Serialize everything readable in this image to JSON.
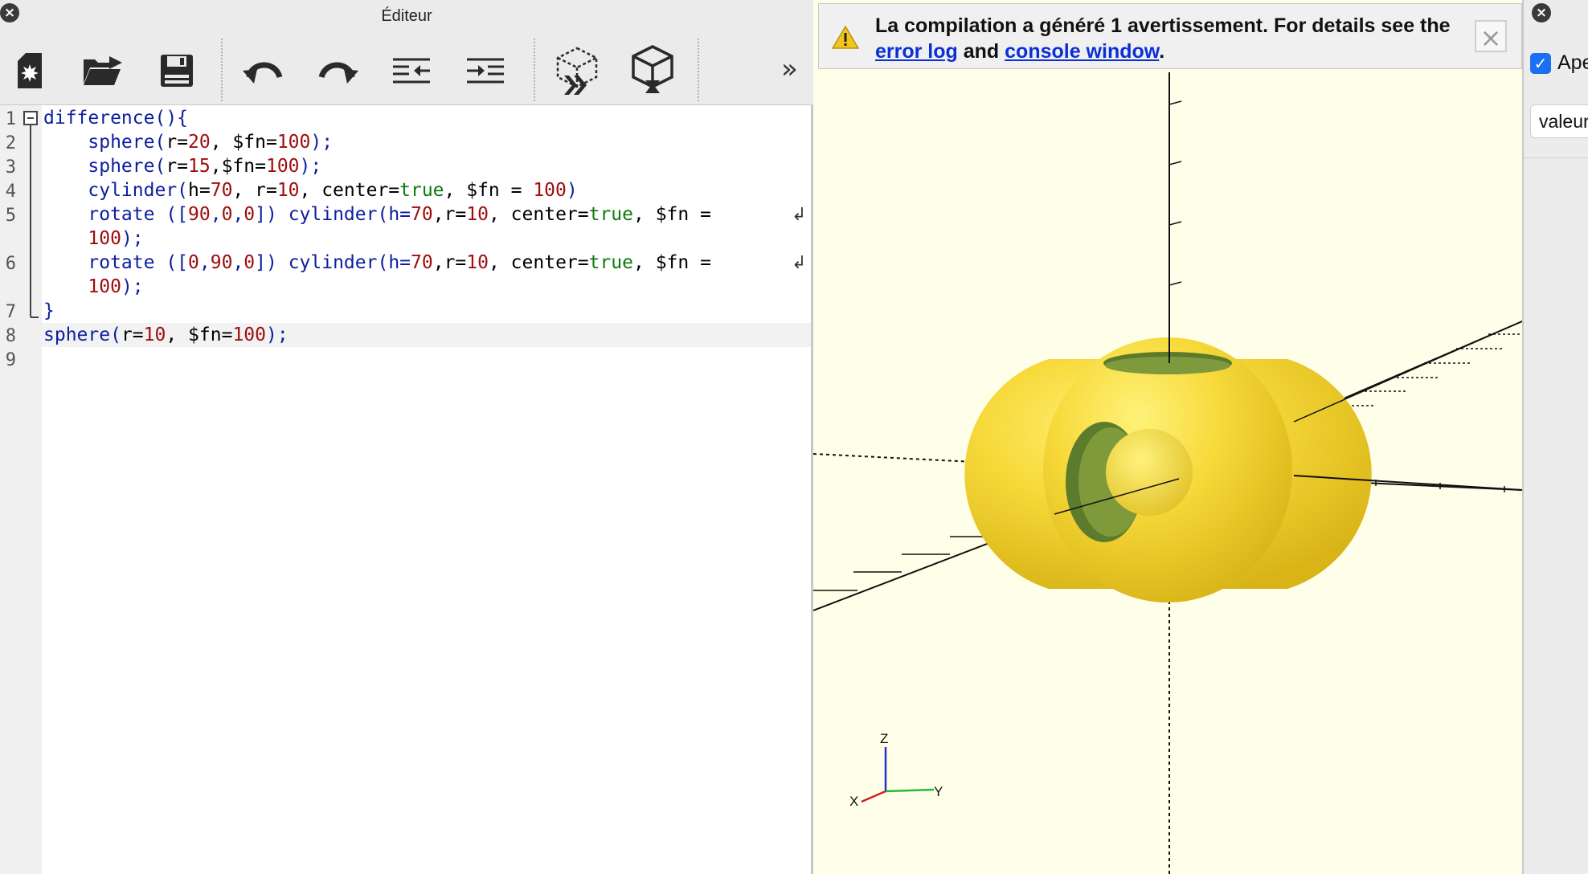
{
  "editor": {
    "title": "Éditeur",
    "close_icon": "×",
    "toolbar": {
      "more_label": "»",
      "buttons": [
        "new-file-icon",
        "open-file-icon",
        "save-icon",
        "undo-icon",
        "redo-icon",
        "unindent-icon",
        "indent-icon",
        "preview-icon",
        "render-icon"
      ]
    },
    "line_numbers": [
      "1",
      "2",
      "3",
      "4",
      "5",
      "",
      "6",
      "",
      "7",
      "8",
      "9"
    ],
    "code": {
      "l1": {
        "a": "difference(){"
      },
      "l2": {
        "a": "    sphere(",
        "b": "r=",
        "c": "20",
        ",": ", $fn=",
        "d": "100",
        "e": ");"
      },
      "l3": {
        "a": "    sphere(",
        "b": "r=",
        "c": "15",
        "s": ",$fn=",
        "d": "100",
        "e": ");"
      },
      "l4": {
        "a": "    cylinder(",
        "b": "h=",
        "c": "70",
        "s": ", r=",
        "c2": "10",
        "s2": ", center=",
        "t": "true",
        "s3": ", $fn = ",
        "d": "100",
        "e": ")"
      },
      "l5": {
        "a": "    rotate ([",
        "n1": "90",
        ",1": ",",
        "n2": "0",
        ",2": ",",
        "n3": "0",
        "s": "]) cylinder(h=",
        "c": "70",
        "s2": ",r=",
        "c2": "10",
        "s3": ", center=",
        "t": "true",
        "s4": ", $fn =",
        "w1": "    ",
        "d": "100",
        "e": ");"
      },
      "l6": {
        "a": "    rotate ([",
        "n1": "0",
        ",1": ",",
        "n2": "90",
        ",2": ",",
        "n3": "0",
        "s": "]) cylinder(h=",
        "c": "70",
        "s2": ",r=",
        "c2": "10",
        "s3": ", center=",
        "t": "true",
        "s4": ", $fn =",
        "w1": "    ",
        "d": "100",
        "e": ");"
      },
      "l7": {
        "a": "}"
      },
      "l8": {
        "a": "sphere(",
        "b": "r=",
        "c": "10",
        "s": ", $fn=",
        "d": "100",
        "e": ");"
      }
    },
    "wrap_icon": "↲"
  },
  "viewport": {
    "warning": {
      "text_before": "La compilation a généré 1 avertissement. For details see the ",
      "link1": "error log",
      "middle": " and ",
      "link2": "console window",
      "end": "."
    },
    "close_icon": "×",
    "axis_labels": {
      "z": "Z",
      "y": "Y",
      "x": "X"
    },
    "colors": {
      "background": "#fffee8",
      "object": "#f7d93a",
      "warning_icon": "#e8b814",
      "link": "#0b2fd6"
    }
  },
  "customizer": {
    "close_icon": "×",
    "apercu_label": "Aperçu automatique",
    "checkbox_mark": "✓",
    "valeur_label": "valeurs par défaut"
  }
}
